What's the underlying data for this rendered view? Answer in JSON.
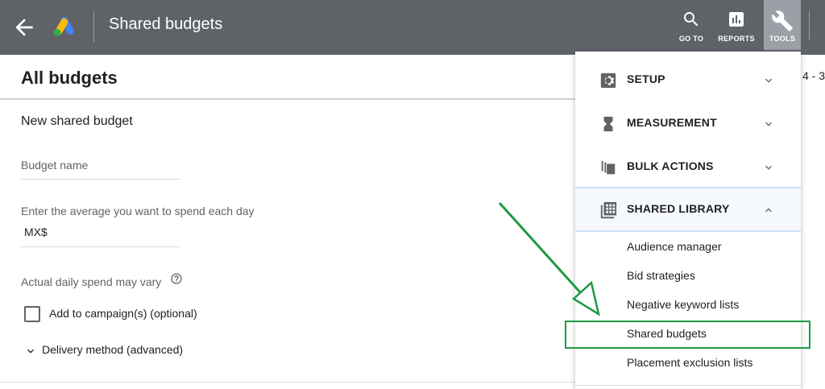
{
  "topbar": {
    "title": "Shared budgets",
    "nav": {
      "goto": "GO TO",
      "reports": "REPORTS",
      "tools": "TOOLS"
    }
  },
  "page": {
    "title": "All budgets",
    "date_fragment": "4 - 3"
  },
  "form": {
    "section_title": "New shared budget",
    "budget_name_label": "Budget name",
    "daily_label": "Enter the average you want to spend each day",
    "currency": "MX$",
    "spend_note": "Actual daily spend may vary",
    "add_campaign_label": "Add to campaign(s) (optional)",
    "delivery_label": "Delivery method (advanced)"
  },
  "menu": {
    "sections": [
      {
        "label": "SETUP",
        "icon": "gear-icon",
        "expanded": false
      },
      {
        "label": "MEASUREMENT",
        "icon": "hourglass-icon",
        "expanded": false
      },
      {
        "label": "BULK ACTIONS",
        "icon": "copy-icon",
        "expanded": false
      },
      {
        "label": "SHARED LIBRARY",
        "icon": "library-icon",
        "expanded": true
      }
    ],
    "shared_library_items": [
      "Audience manager",
      "Bid strategies",
      "Negative keyword lists",
      "Shared budgets",
      "Placement exclusion lists"
    ]
  },
  "colors": {
    "topbar": "#5f6368",
    "annotation": "#1e9a45"
  }
}
